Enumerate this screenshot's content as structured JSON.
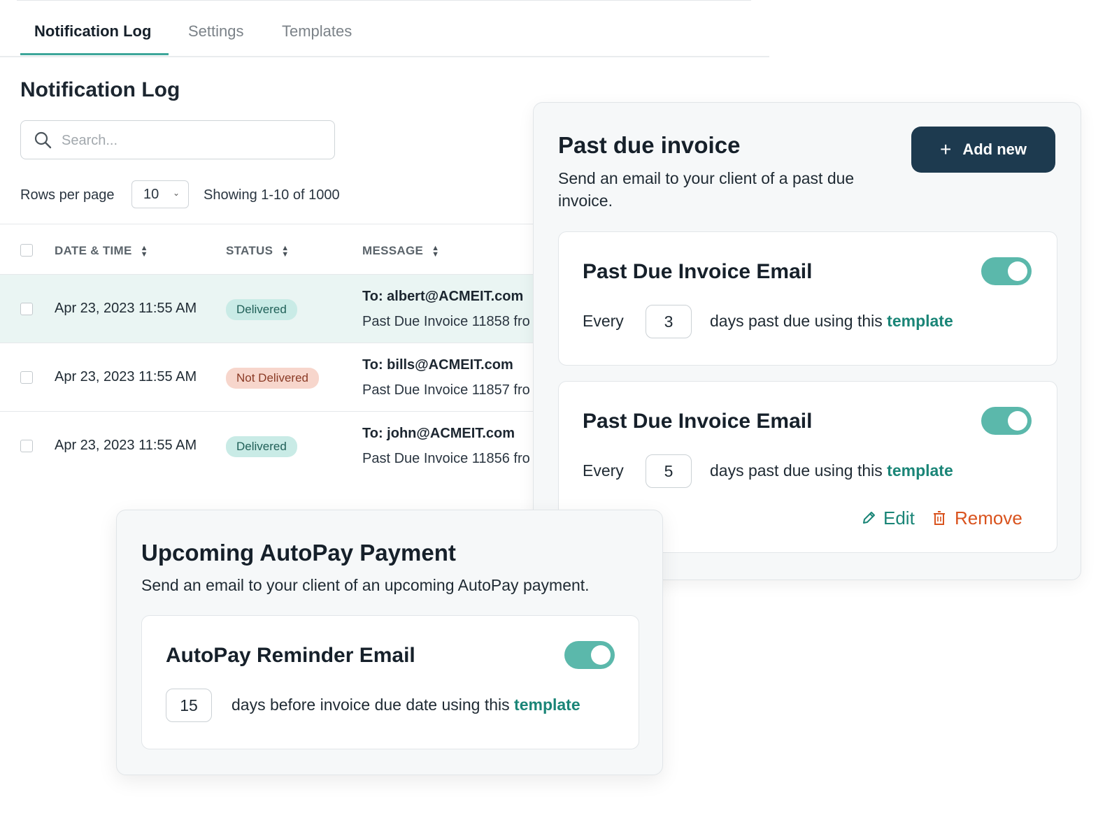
{
  "tabs": [
    {
      "label": "Notification Log",
      "active": true
    },
    {
      "label": "Settings",
      "active": false
    },
    {
      "label": "Templates",
      "active": false
    }
  ],
  "log": {
    "title": "Notification Log",
    "search_placeholder": "Search...",
    "rows_per_page_label": "Rows per page",
    "rows_per_page_value": "10",
    "showing": "Showing 1-10 of 1000",
    "columns": [
      "DATE & TIME",
      "STATUS",
      "MESSAGE"
    ],
    "rows": [
      {
        "date": "Apr 23, 2023 11:55 AM",
        "status": "Delivered",
        "to": "To: albert@ACMEIT.com",
        "message": "Past Due Invoice 11858 fro"
      },
      {
        "date": "Apr 23, 2023 11:55 AM",
        "status": "Not Delivered",
        "to": "To: bills@ACMEIT.com",
        "message": "Past Due Invoice 11857 fro"
      },
      {
        "date": "Apr 23, 2023 11:55 AM",
        "status": "Delivered",
        "to": "To: john@ACMEIT.com",
        "message": "Past Due Invoice 11856 fro"
      }
    ]
  },
  "past_due": {
    "title": "Past due invoice",
    "description": "Send an email to your client of a past due invoice.",
    "add_button": "Add new",
    "rules": [
      {
        "title": "Past Due Invoice Email",
        "enabled": true,
        "every": "Every",
        "days": "3",
        "text": "days past due using this ",
        "link": "template"
      },
      {
        "title": "Past Due Invoice Email",
        "enabled": true,
        "every": "Every",
        "days": "5",
        "text": "days past due using this ",
        "link": "template",
        "edit": "Edit",
        "remove": "Remove"
      }
    ]
  },
  "autopay": {
    "title": "Upcoming AutoPay Payment",
    "description": "Send an email to your client of an upcoming AutoPay payment.",
    "rule": {
      "title": "AutoPay Reminder Email",
      "enabled": true,
      "days": "15",
      "text": "days before invoice due date using this ",
      "link": "template"
    }
  },
  "colors": {
    "accent": "#3ea69a",
    "toggle_on": "#5bb8ab",
    "primary_button": "#1d3a4f",
    "link": "#1a8577",
    "remove": "#d9531e",
    "delivered_bg": "#c9ebe6",
    "not_delivered_bg": "#f7d6cc"
  },
  "icons": [
    "search-icon",
    "sort-icon",
    "chevron-down-icon",
    "plus-icon",
    "pencil-icon",
    "trash-icon"
  ]
}
